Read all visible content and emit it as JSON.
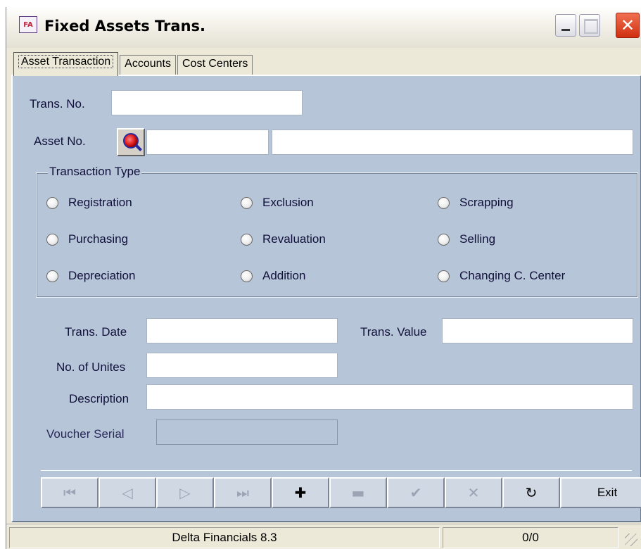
{
  "window": {
    "title": "Fixed Assets Trans.",
    "icon_text": "FA",
    "close_glyph": "✕"
  },
  "tabs": [
    {
      "label": "Asset Transaction",
      "active": true
    },
    {
      "label": "Accounts",
      "active": false
    },
    {
      "label": "Cost Centers",
      "active": false
    }
  ],
  "form": {
    "trans_no_label": "Trans. No.",
    "trans_no_value": "",
    "asset_no_label": "Asset No.",
    "asset_code_value": "",
    "asset_name_value": "",
    "group_title": "Transaction Type",
    "transaction_types": [
      "Registration",
      "Exclusion",
      "Scrapping",
      "Purchasing",
      "Revaluation",
      "Selling",
      "Depreciation",
      "Addition",
      "Changing C. Center"
    ],
    "trans_date_label": "Trans. Date",
    "trans_date_value": "",
    "trans_value_label": "Trans. Value",
    "trans_value_value": "",
    "units_label": "No. of Unites",
    "units_value": "",
    "description_label": "Description",
    "description_value": "",
    "voucher_label": "Voucher Serial",
    "voucher_value": ""
  },
  "toolbar": {
    "first": "⏮",
    "prev": "◁",
    "next": "▷",
    "last": "⏭",
    "add": "✚",
    "delete": "▬",
    "save": "✔",
    "cancel": "✕",
    "refresh": "↻",
    "exit_label": "Exit"
  },
  "status": {
    "app_name": "Delta Financials 8.3",
    "record_counter": "0/0"
  },
  "colors": {
    "panel": "#b7c5d8",
    "close_button": "#d03010"
  }
}
